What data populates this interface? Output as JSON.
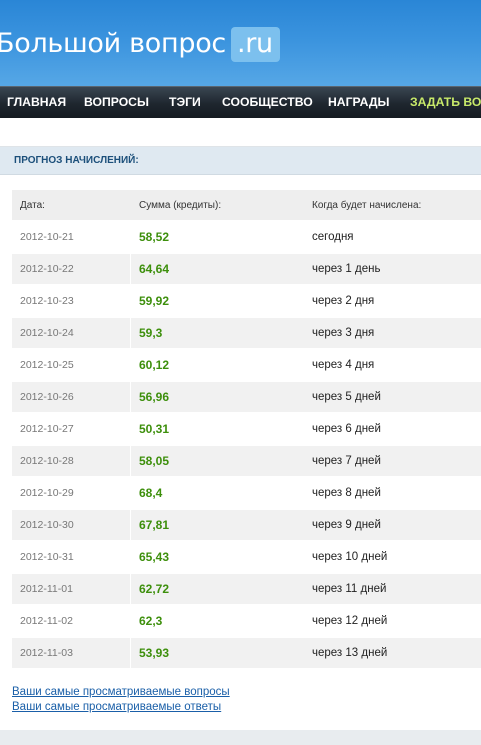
{
  "header": {
    "logo_text": "Большой вопрос",
    "logo_badge": ".ru"
  },
  "nav": {
    "items": [
      "ГЛАВНАЯ",
      "ВОПРОСЫ",
      "ТЭГИ",
      "СООБЩЕСТВО",
      "НАГРАДЫ",
      "ЗАДАТЬ ВОПРОС"
    ]
  },
  "section": {
    "title": "ПРОГНОЗ НАЧИСЛЕНИЙ:"
  },
  "table": {
    "headers": {
      "date": "Дата:",
      "amount": "Сумма (кредиты):",
      "when": "Когда будет начислена:"
    },
    "rows": [
      {
        "date": "2012-10-21",
        "amount": "58,52",
        "when": "сегодня"
      },
      {
        "date": "2012-10-22",
        "amount": "64,64",
        "when": "через 1 день"
      },
      {
        "date": "2012-10-23",
        "amount": "59,92",
        "when": "через 2 дня"
      },
      {
        "date": "2012-10-24",
        "amount": "59,3",
        "when": "через 3 дня"
      },
      {
        "date": "2012-10-25",
        "amount": "60,12",
        "when": "через 4 дня"
      },
      {
        "date": "2012-10-26",
        "amount": "56,96",
        "when": "через 5 дней"
      },
      {
        "date": "2012-10-27",
        "amount": "50,31",
        "when": "через 6 дней"
      },
      {
        "date": "2012-10-28",
        "amount": "58,05",
        "when": "через 7 дней"
      },
      {
        "date": "2012-10-29",
        "amount": "68,4",
        "when": "через 8 дней"
      },
      {
        "date": "2012-10-30",
        "amount": "67,81",
        "when": "через 9 дней"
      },
      {
        "date": "2012-10-31",
        "amount": "65,43",
        "when": "через 10 дней"
      },
      {
        "date": "2012-11-01",
        "amount": "62,72",
        "when": "через 11 дней"
      },
      {
        "date": "2012-11-02",
        "amount": "62,3",
        "when": "через 12 дней"
      },
      {
        "date": "2012-11-03",
        "amount": "53,93",
        "when": "через 13 дней"
      }
    ]
  },
  "links": {
    "questions": "Ваши самые просматриваемые вопросы",
    "answers": "Ваши самые просматриваемые ответы"
  },
  "colors": {
    "header_blue": "#2a86d6",
    "amount_green": "#3d8f0c",
    "nav_accent": "#c8ea6a",
    "link_blue": "#1a5fa8"
  }
}
